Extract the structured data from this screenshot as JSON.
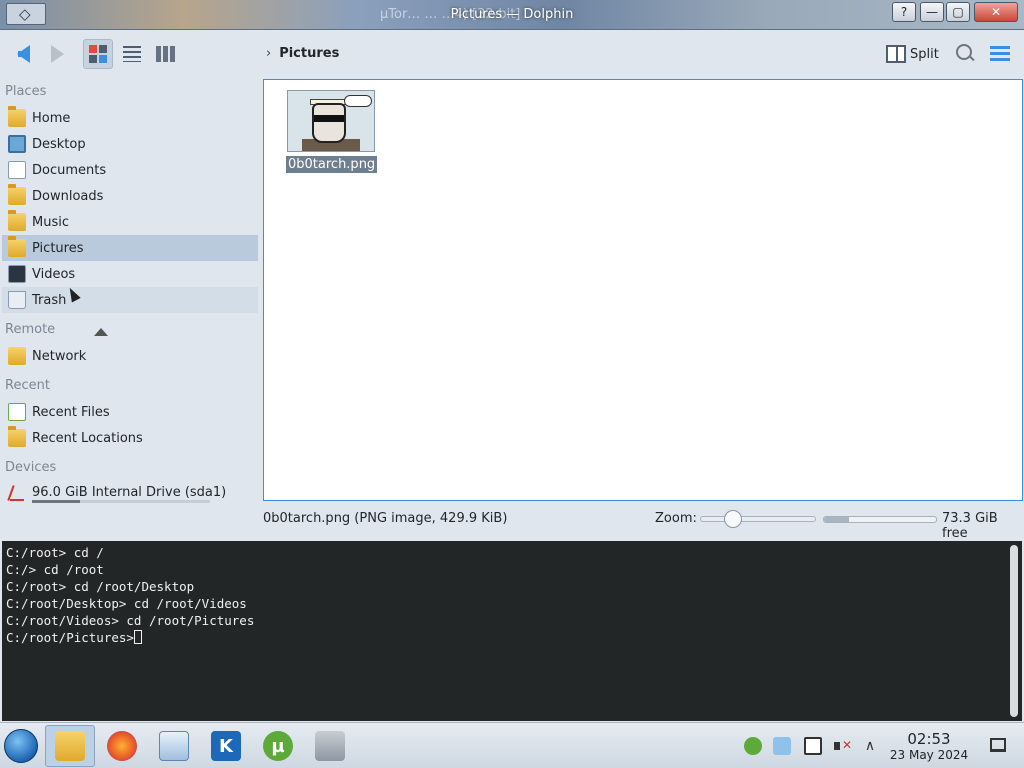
{
  "window": {
    "title": "Pictures — Dolphin",
    "ghost_title": "µTor… … …4) [32-bit]",
    "help_label": "?",
    "minimize_label": "—",
    "maximize_label": "▢",
    "close_label": "✕"
  },
  "toolbar": {
    "breadcrumb_chevron": "›",
    "breadcrumb": "Pictures",
    "split_label": "Split"
  },
  "places": {
    "sections": {
      "places": "Places",
      "remote": "Remote",
      "recent": "Recent",
      "devices": "Devices"
    },
    "items": [
      {
        "label": "Home",
        "icon": "home-folder-icon"
      },
      {
        "label": "Desktop",
        "icon": "desktop-icon"
      },
      {
        "label": "Documents",
        "icon": "documents-icon"
      },
      {
        "label": "Downloads",
        "icon": "downloads-folder-icon"
      },
      {
        "label": "Music",
        "icon": "music-folder-icon"
      },
      {
        "label": "Pictures",
        "icon": "pictures-folder-icon"
      },
      {
        "label": "Videos",
        "icon": "videos-icon"
      },
      {
        "label": "Trash",
        "icon": "trash-icon"
      }
    ],
    "remote_items": [
      {
        "label": "Network",
        "icon": "network-folder-icon"
      }
    ],
    "recent_items": [
      {
        "label": "Recent Files",
        "icon": "recent-files-icon"
      },
      {
        "label": "Recent Locations",
        "icon": "recent-locations-icon"
      }
    ],
    "devices": [
      {
        "label": "96.0 GiB Internal Drive (sda1)",
        "icon": "drive-icon",
        "usage_fraction": 0.27
      }
    ]
  },
  "files": [
    {
      "name": "0b0tarch.png",
      "selected": true
    }
  ],
  "status": {
    "selection": "0b0tarch.png (PNG image, 429.9 KiB)",
    "zoom_label": "Zoom:",
    "zoom_fraction": 0.22,
    "free_space": "73.3 GiB free",
    "used_fraction": 0.22
  },
  "terminal": {
    "lines": [
      "C:/root> cd /",
      "C:/> cd /root",
      "C:/root> cd /root/Desktop",
      "C:/root/Desktop> cd /root/Videos",
      "C:/root/Videos> cd /root/Pictures"
    ],
    "prompt": "C:/root/Pictures>"
  },
  "taskbar": {
    "apps": [
      {
        "name": "dolphin-file-manager",
        "icon": "folder-icon",
        "active": true
      },
      {
        "name": "firefox",
        "icon": "firefox-icon",
        "active": false
      },
      {
        "name": "system-settings",
        "icon": "settings-icon",
        "active": false
      },
      {
        "name": "kde-discover",
        "icon": "kde-icon",
        "glyph": "K",
        "active": false
      },
      {
        "name": "utorrent",
        "icon": "utorrent-icon",
        "glyph": "µ",
        "active": false
      },
      {
        "name": "gimp",
        "icon": "gimp-icon",
        "active": false
      }
    ],
    "tray_up": "∧",
    "clock": {
      "time": "02:53",
      "date": "23 May 2024"
    }
  }
}
